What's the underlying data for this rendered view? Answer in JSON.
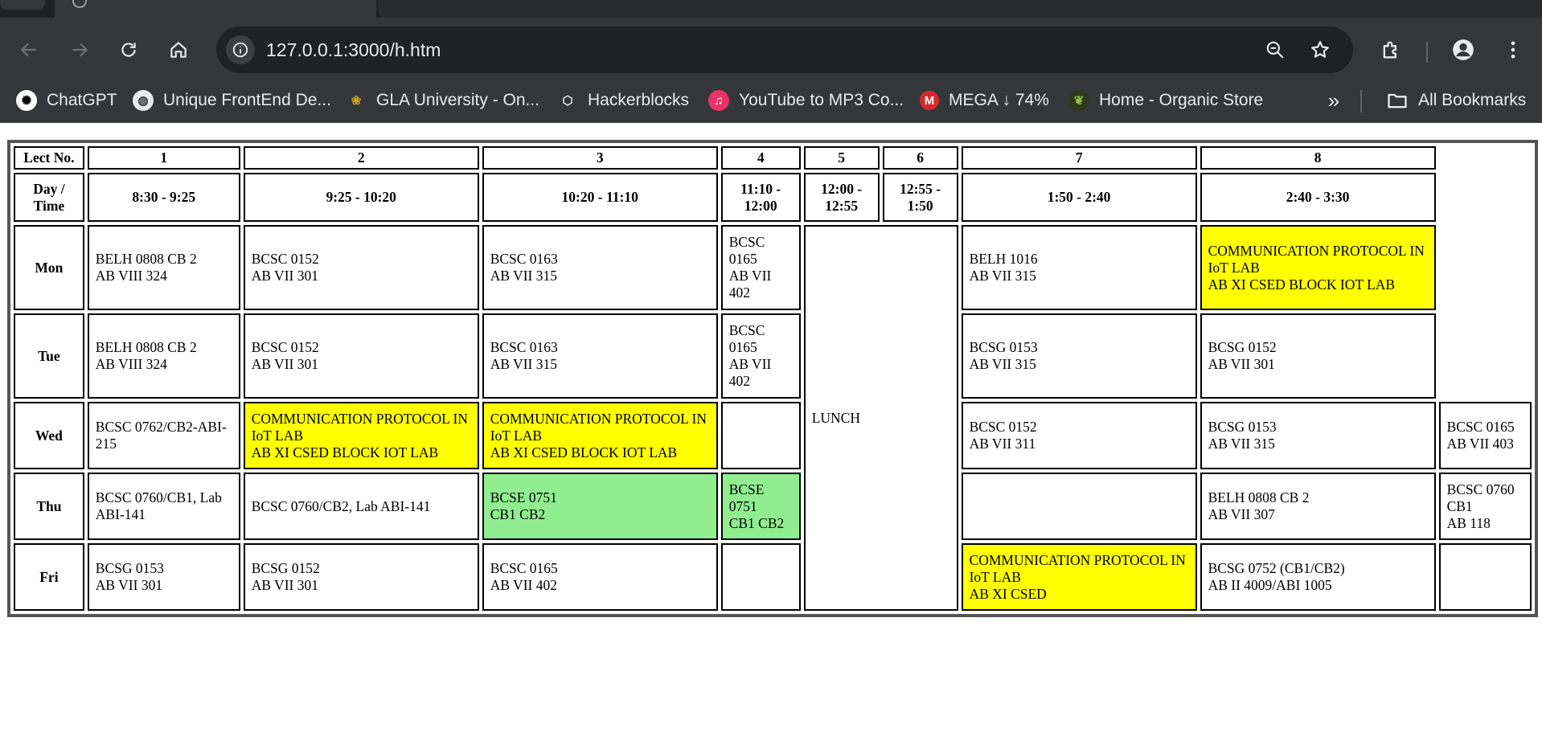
{
  "browser": {
    "url": "127.0.0.1:3000/h.htm",
    "bookmarks": [
      {
        "label": "ChatGPT",
        "icon": "chatgpt-icon",
        "color": "#ffffff"
      },
      {
        "label": "Unique FrontEnd De...",
        "icon": "globe-icon",
        "color": "#e8eaed"
      },
      {
        "label": "GLA University - On...",
        "icon": "gla-logo-icon",
        "color": "#c8a82c"
      },
      {
        "label": "Hackerblocks",
        "icon": "hackerblocks-icon",
        "color": "#e8eaed"
      },
      {
        "label": "YouTube to MP3 Co...",
        "icon": "music-note-icon",
        "color": "#e8336a"
      },
      {
        "label": "MEGA ↓ 74%",
        "icon": "mega-icon",
        "color": "#d9272e"
      },
      {
        "label": "Home - Organic Store",
        "icon": "organic-store-icon",
        "color": "#8bc34a"
      }
    ],
    "all_bookmarks_label": "All Bookmarks"
  },
  "timetable": {
    "colors": {
      "lab": "#ffff00",
      "green": "#90ee90"
    },
    "lect_header": "Lect No.",
    "lect_numbers": [
      "1",
      "2",
      "3",
      "4",
      "5",
      "6",
      "7",
      "8"
    ],
    "day_time_header": "Day / Time",
    "times": [
      "8:30 - 9:25",
      "9:25 - 10:20",
      "10:20 - 11:10",
      "11:10 - 12:00",
      "12:00 - 12:55",
      "12:55 - 1:50",
      "1:50 - 2:40",
      "2:40 - 3:30"
    ],
    "lunch_label": "LUNCH",
    "days": [
      {
        "day": "Mon",
        "c1": {
          "l1": "BELH 0808 CB 2",
          "l2": "AB VIII 324"
        },
        "c2": {
          "l1": "BCSC 0152",
          "l2": "AB VII 301"
        },
        "c3": {
          "l1": "BCSC 0163",
          "l2": "AB VII 315"
        },
        "c4": {
          "l1": "BCSC 0165",
          "l2": "AB VII 402"
        },
        "c7": {
          "l1": "BELH 1016",
          "l2": "AB VII 315"
        },
        "c8": {
          "l1": "COMMUNICATION PROTOCOL IN IoT LAB",
          "l2": "AB XI CSED BLOCK IOT LAB"
        }
      },
      {
        "day": "Tue",
        "c1": {
          "l1": "BELH 0808 CB 2",
          "l2": "AB VIII 324"
        },
        "c2": {
          "l1": "BCSC 0152",
          "l2": "AB VII 301"
        },
        "c3": {
          "l1": "BCSC 0163",
          "l2": "AB VII 315"
        },
        "c4": {
          "l1": "BCSC 0165",
          "l2": "AB VII 402"
        },
        "c7": {
          "l1": "BCSG 0153",
          "l2": "AB VII 315"
        },
        "c8": {
          "l1": "BCSG 0152",
          "l2": "AB VII 301"
        }
      },
      {
        "day": "Wed",
        "c1": {
          "l1": "BCSC 0762/CB2-ABI-215"
        },
        "c2": {
          "l1": "COMMUNICATION PROTOCOL IN IoT LAB",
          "l2": "AB XI CSED BLOCK IOT LAB"
        },
        "c3": {
          "l1": "COMMUNICATION PROTOCOL IN IoT LAB",
          "l2": "AB XI CSED BLOCK IOT LAB"
        },
        "c7": {
          "l1": "BCSC 0152",
          "l2": "AB VII 311"
        },
        "c8": {
          "l1": "BCSG 0153",
          "l2": "AB VII 315"
        },
        "c9": {
          "l1": "BCSC 0165",
          "l2": "AB VII 403"
        }
      },
      {
        "day": "Thu",
        "c1": {
          "l1": "BCSC 0760/CB1, Lab ABI-141"
        },
        "c2": {
          "l1": "BCSC 0760/CB2, Lab ABI-141"
        },
        "c3": {
          "l1": "BCSE 0751",
          "l2": "CB1 CB2"
        },
        "c4": {
          "l1": "BCSE 0751",
          "l2": "CB1 CB2"
        },
        "c8": {
          "l1": "BELH 0808 CB 2",
          "l2": "AB VII 307"
        },
        "c9": {
          "l1": "BCSC 0760 CB1",
          "l2": "AB 118"
        }
      },
      {
        "day": "Fri",
        "c1": {
          "l1": "BCSG 0153",
          "l2": "AB VII 301"
        },
        "c2": {
          "l1": "BCSG 0152",
          "l2": "AB VII 301"
        },
        "c3": {
          "l1": "BCSC 0165",
          "l2": "AB VII 402"
        },
        "c7": {
          "l1": "COMMUNICATION PROTOCOL IN IoT LAB",
          "l2": "AB XI CSED"
        },
        "c8": {
          "l1": "BCSG 0752 (CB1/CB2)",
          "l2": "AB II 4009/ABI 1005"
        }
      }
    ]
  }
}
